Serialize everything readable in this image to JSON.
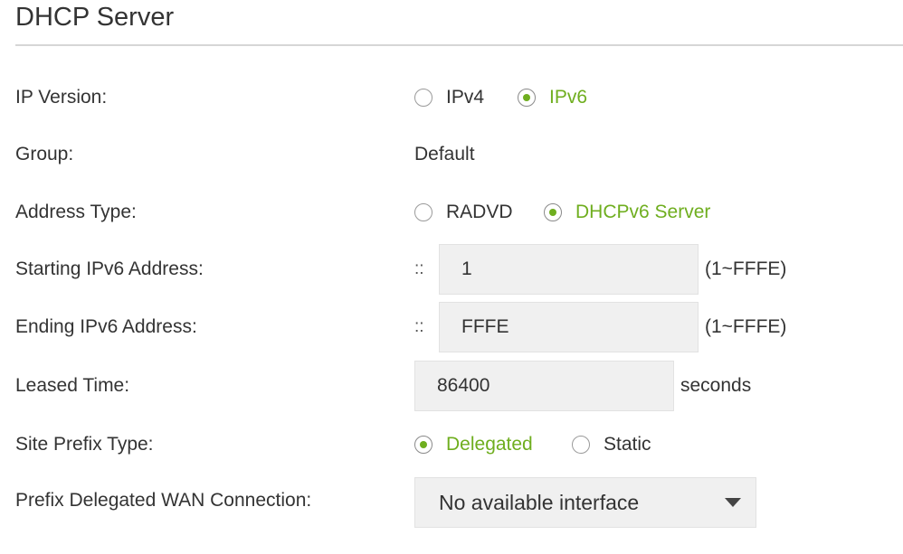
{
  "title": "DHCP Server",
  "colors": {
    "accent": "#6fae1f",
    "field_bg": "#f0f0f0",
    "divider": "#d6d6d6"
  },
  "ip_version": {
    "label": "IP Version:",
    "options": [
      {
        "label": "IPv4",
        "checked": false
      },
      {
        "label": "IPv6",
        "checked": true
      }
    ]
  },
  "group": {
    "label": "Group:",
    "value": "Default"
  },
  "address_type": {
    "label": "Address Type:",
    "options": [
      {
        "label": "RADVD",
        "checked": false
      },
      {
        "label": "DHCPv6 Server",
        "checked": true
      }
    ]
  },
  "starting_address": {
    "label": "Starting IPv6 Address:",
    "prefix": "::",
    "value": "1",
    "hint": "(1~FFFE)"
  },
  "ending_address": {
    "label": "Ending IPv6 Address:",
    "prefix": "::",
    "value": "FFFE",
    "hint": "(1~FFFE)"
  },
  "leased_time": {
    "label": "Leased Time:",
    "value": "86400",
    "unit": "seconds"
  },
  "site_prefix_type": {
    "label": "Site Prefix Type:",
    "options": [
      {
        "label": "Delegated",
        "checked": true
      },
      {
        "label": "Static",
        "checked": false
      }
    ]
  },
  "prefix_wan": {
    "label": "Prefix Delegated WAN Connection:",
    "selected": "No available interface"
  }
}
